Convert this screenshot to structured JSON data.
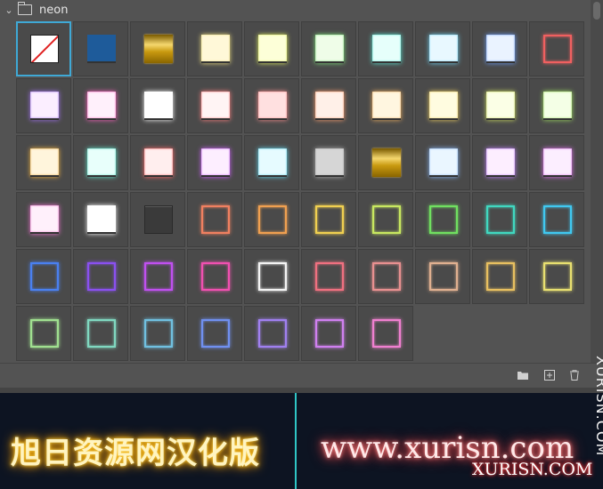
{
  "panel": {
    "group_name": "neon",
    "icons": {
      "collapse": "chevron-down-icon",
      "folder": "folder-icon"
    }
  },
  "styles": [
    {
      "name": "none",
      "kind": "none"
    },
    {
      "kind": "fill",
      "color": "#1e5b9a"
    },
    {
      "kind": "gold"
    },
    {
      "kind": "fill",
      "color": "#fff8d8",
      "glow": "#f0e080"
    },
    {
      "kind": "fill",
      "color": "#fdffd8",
      "glow": "#e0ee60"
    },
    {
      "kind": "fill",
      "color": "#effde8",
      "glow": "#7ee27a"
    },
    {
      "kind": "fill",
      "color": "#e6fffb",
      "glow": "#58e6d3"
    },
    {
      "kind": "fill",
      "color": "#e8f8ff",
      "glow": "#6dd3f5"
    },
    {
      "kind": "fill",
      "color": "#eaf3ff",
      "glow": "#6a9cf7"
    },
    {
      "kind": "outline",
      "color": "#f06060"
    },
    {
      "kind": "fill",
      "color": "#fbeeff",
      "glow": "#a070f0"
    },
    {
      "kind": "fill",
      "color": "#fff0fb",
      "glow": "#ff60c0"
    },
    {
      "kind": "fill",
      "color": "#ffffff",
      "glow": "#ffffff"
    },
    {
      "kind": "fill",
      "color": "#fff4f4",
      "glow": "#ff8080"
    },
    {
      "kind": "fill",
      "color": "#ffe0e0",
      "glow": "#ff9090"
    },
    {
      "kind": "fill",
      "color": "#fff0e8",
      "glow": "#ffa070"
    },
    {
      "kind": "fill",
      "color": "#fff6e0",
      "glow": "#f0b060"
    },
    {
      "kind": "fill",
      "color": "#fffce0",
      "glow": "#f0d060"
    },
    {
      "kind": "fill",
      "color": "#fbffe6",
      "glow": "#d0e060"
    },
    {
      "kind": "fill",
      "color": "#f4ffe6",
      "glow": "#a0e060"
    },
    {
      "kind": "fill",
      "color": "#fff5dc",
      "glow": "#f0b040"
    },
    {
      "kind": "fill",
      "color": "#e8fffb",
      "glow": "#60e8d0"
    },
    {
      "kind": "fill",
      "color": "#ffeeee",
      "glow": "#ff6a6a"
    },
    {
      "kind": "fill",
      "color": "#fdeeff",
      "glow": "#d060ff"
    },
    {
      "kind": "fill",
      "color": "#e6fbff",
      "glow": "#60d8f0"
    },
    {
      "kind": "fill",
      "color": "#d6d6d6",
      "glow": "#b0b0b0"
    },
    {
      "kind": "gold"
    },
    {
      "kind": "fill",
      "color": "#eaf6ff",
      "glow": "#8ab8f8"
    },
    {
      "kind": "fill",
      "color": "#fdeeff",
      "glow": "#c080ff"
    },
    {
      "kind": "fill",
      "color": "#fceeff",
      "glow": "#e070f0"
    },
    {
      "kind": "fill",
      "color": "#fff0fb",
      "glow": "#f070d0"
    },
    {
      "kind": "fill",
      "color": "#ffffff",
      "glow": "#ffffff"
    },
    {
      "kind": "dark"
    },
    {
      "kind": "outline",
      "color": "#f08060"
    },
    {
      "kind": "outline",
      "color": "#f0a050"
    },
    {
      "kind": "outline",
      "color": "#f0d050"
    },
    {
      "kind": "outline",
      "color": "#c8e860"
    },
    {
      "kind": "outline",
      "color": "#70e060"
    },
    {
      "kind": "outline",
      "color": "#40d8c0"
    },
    {
      "kind": "outline",
      "color": "#40c8f0"
    },
    {
      "kind": "outline",
      "color": "#4a80f0"
    },
    {
      "kind": "outline",
      "color": "#8a50f0"
    },
    {
      "kind": "outline",
      "color": "#c050f0"
    },
    {
      "kind": "outline",
      "color": "#f050b0"
    },
    {
      "kind": "outline",
      "color": "#f4f4f4"
    },
    {
      "kind": "outline",
      "color": "#f07080"
    },
    {
      "kind": "outline",
      "color": "#e89090"
    },
    {
      "kind": "outline",
      "color": "#e0b090"
    },
    {
      "kind": "outline",
      "color": "#e8c060"
    },
    {
      "kind": "outline",
      "color": "#e8e070"
    },
    {
      "kind": "outline",
      "color": "#a0e090"
    },
    {
      "kind": "outline",
      "color": "#80d8c0"
    },
    {
      "kind": "outline",
      "color": "#70c0e0"
    },
    {
      "kind": "outline",
      "color": "#7090f0"
    },
    {
      "kind": "outline",
      "color": "#a080f0"
    },
    {
      "kind": "outline",
      "color": "#d080f0"
    },
    {
      "kind": "outline",
      "color": "#f080d0"
    }
  ],
  "footer": {
    "icons": [
      "folder-icon",
      "new-style-icon",
      "trash-icon"
    ]
  },
  "preview": {
    "left_text": "旭日资源网汉化版",
    "right_text": "www.xurisn.com",
    "watermark_vertical": "XURISN.COM",
    "watermark_bottom": "XURISN.COM"
  },
  "colors": {
    "selection": "#3fa9d6",
    "preview_divider": "#2fc6c6",
    "panel_bg": "#535353"
  }
}
